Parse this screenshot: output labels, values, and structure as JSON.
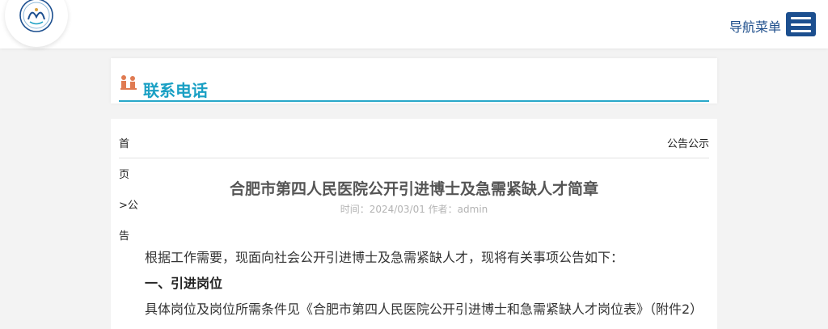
{
  "header": {
    "nav_label": "导航菜单",
    "logo_icon": "hospital-logo-icon",
    "menu_icon": "hamburger-menu-icon",
    "accent_color": "#1c4f8f"
  },
  "contact": {
    "title": "联系电话",
    "icon": "people-contact-icon",
    "accent_color": "#1aa0c4"
  },
  "breadcrumb": {
    "left_lines": [
      "首",
      "页",
      ">公",
      "告"
    ],
    "right": "公告公示"
  },
  "article": {
    "title": "合肥市第四人民医院公开引进博士及急需紧缺人才简章",
    "meta": "时间：2024/03/01 作者：admin",
    "paragraphs": [
      "根据工作需要，现面向社会公开引进博士及急需紧缺人才，现将有关事项公告如下：",
      "一、引进岗位",
      "具体岗位及岗位所需条件见《合肥市第四人民医院公开引进博士和急需紧缺人才岗位表》（附件2）"
    ]
  }
}
